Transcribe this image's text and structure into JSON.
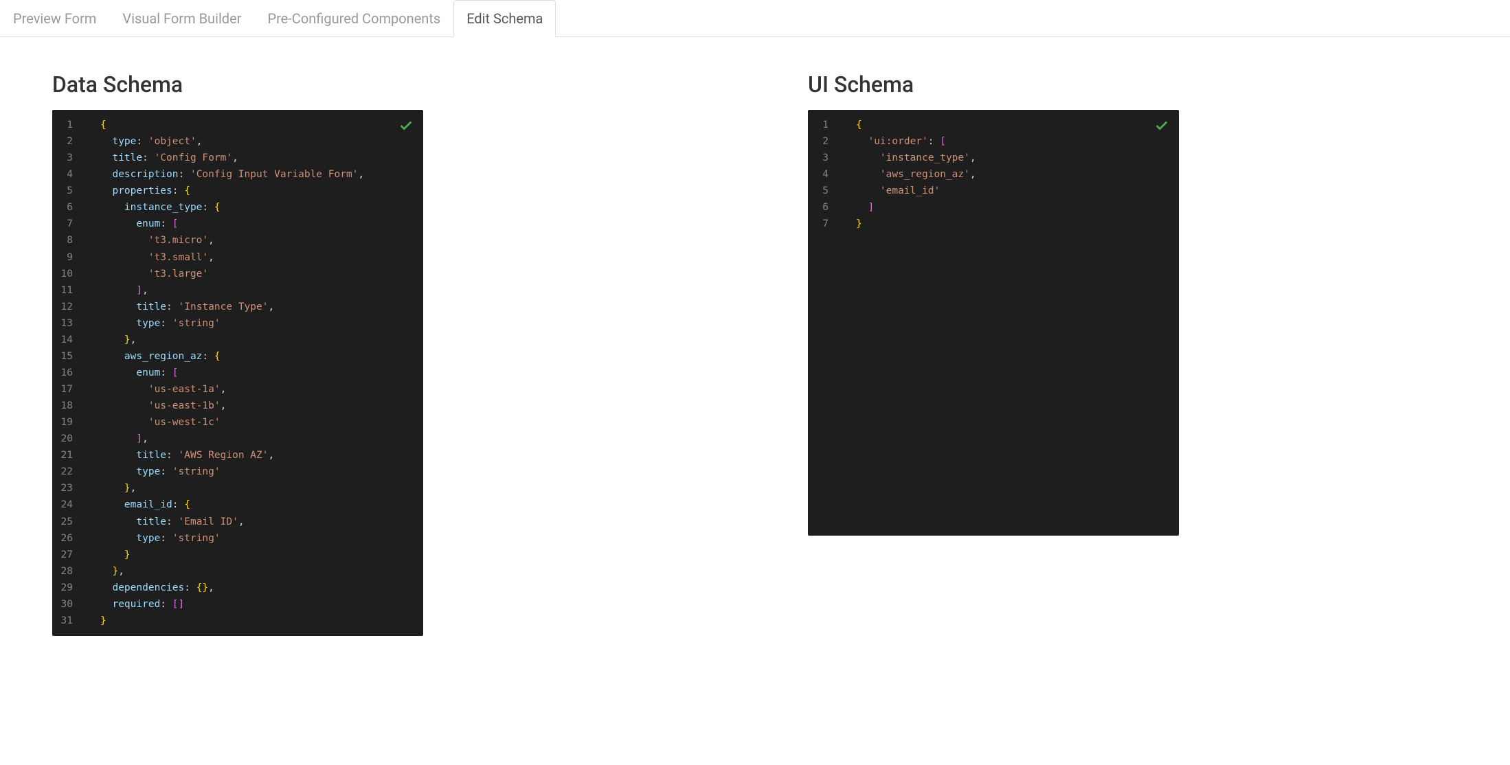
{
  "tabs": {
    "preview": "Preview Form",
    "builder": "Visual Form Builder",
    "precfg": "Pre-Configured Components",
    "edit": "Edit Schema"
  },
  "left": {
    "title": "Data Schema",
    "lines": [
      [
        {
          "t": "{",
          "c": "brace"
        }
      ],
      [
        {
          "t": "  "
        },
        {
          "t": "type",
          "c": "key"
        },
        {
          "t": ": "
        },
        {
          "t": "'object'",
          "c": "str"
        },
        {
          "t": ","
        }
      ],
      [
        {
          "t": "  "
        },
        {
          "t": "title",
          "c": "key"
        },
        {
          "t": ": "
        },
        {
          "t": "'Config Form'",
          "c": "str"
        },
        {
          "t": ","
        }
      ],
      [
        {
          "t": "  "
        },
        {
          "t": "description",
          "c": "key"
        },
        {
          "t": ": "
        },
        {
          "t": "'Config Input Variable Form'",
          "c": "str"
        },
        {
          "t": ","
        }
      ],
      [
        {
          "t": "  "
        },
        {
          "t": "properties",
          "c": "key"
        },
        {
          "t": ": "
        },
        {
          "t": "{",
          "c": "brace"
        }
      ],
      [
        {
          "t": "    "
        },
        {
          "t": "instance_type",
          "c": "key"
        },
        {
          "t": ": "
        },
        {
          "t": "{",
          "c": "brace"
        }
      ],
      [
        {
          "t": "      "
        },
        {
          "t": "enum",
          "c": "key"
        },
        {
          "t": ": "
        },
        {
          "t": "[",
          "c": "bracket"
        }
      ],
      [
        {
          "t": "        "
        },
        {
          "t": "'t3.micro'",
          "c": "str"
        },
        {
          "t": ","
        }
      ],
      [
        {
          "t": "        "
        },
        {
          "t": "'t3.small'",
          "c": "str"
        },
        {
          "t": ","
        }
      ],
      [
        {
          "t": "        "
        },
        {
          "t": "'t3.large'",
          "c": "str"
        }
      ],
      [
        {
          "t": "      "
        },
        {
          "t": "]",
          "c": "bracket"
        },
        {
          "t": ","
        }
      ],
      [
        {
          "t": "      "
        },
        {
          "t": "title",
          "c": "key"
        },
        {
          "t": ": "
        },
        {
          "t": "'Instance Type'",
          "c": "str"
        },
        {
          "t": ","
        }
      ],
      [
        {
          "t": "      "
        },
        {
          "t": "type",
          "c": "key"
        },
        {
          "t": ": "
        },
        {
          "t": "'string'",
          "c": "str"
        }
      ],
      [
        {
          "t": "    "
        },
        {
          "t": "}",
          "c": "brace"
        },
        {
          "t": ","
        }
      ],
      [
        {
          "t": "    "
        },
        {
          "t": "aws_region_az",
          "c": "key"
        },
        {
          "t": ": "
        },
        {
          "t": "{",
          "c": "brace"
        }
      ],
      [
        {
          "t": "      "
        },
        {
          "t": "enum",
          "c": "key"
        },
        {
          "t": ": "
        },
        {
          "t": "[",
          "c": "bracket"
        }
      ],
      [
        {
          "t": "        "
        },
        {
          "t": "'us-east-1a'",
          "c": "str"
        },
        {
          "t": ","
        }
      ],
      [
        {
          "t": "        "
        },
        {
          "t": "'us-east-1b'",
          "c": "str"
        },
        {
          "t": ","
        }
      ],
      [
        {
          "t": "        "
        },
        {
          "t": "'us-west-1c'",
          "c": "str"
        }
      ],
      [
        {
          "t": "      "
        },
        {
          "t": "]",
          "c": "bracket"
        },
        {
          "t": ","
        }
      ],
      [
        {
          "t": "      "
        },
        {
          "t": "title",
          "c": "key"
        },
        {
          "t": ": "
        },
        {
          "t": "'AWS Region AZ'",
          "c": "str"
        },
        {
          "t": ","
        }
      ],
      [
        {
          "t": "      "
        },
        {
          "t": "type",
          "c": "key"
        },
        {
          "t": ": "
        },
        {
          "t": "'string'",
          "c": "str"
        }
      ],
      [
        {
          "t": "    "
        },
        {
          "t": "}",
          "c": "brace"
        },
        {
          "t": ","
        }
      ],
      [
        {
          "t": "    "
        },
        {
          "t": "email_id",
          "c": "key"
        },
        {
          "t": ": "
        },
        {
          "t": "{",
          "c": "brace"
        }
      ],
      [
        {
          "t": "      "
        },
        {
          "t": "title",
          "c": "key"
        },
        {
          "t": ": "
        },
        {
          "t": "'Email ID'",
          "c": "str"
        },
        {
          "t": ","
        }
      ],
      [
        {
          "t": "      "
        },
        {
          "t": "type",
          "c": "key"
        },
        {
          "t": ": "
        },
        {
          "t": "'string'",
          "c": "str"
        }
      ],
      [
        {
          "t": "    "
        },
        {
          "t": "}",
          "c": "brace"
        }
      ],
      [
        {
          "t": "  "
        },
        {
          "t": "}",
          "c": "brace"
        },
        {
          "t": ","
        }
      ],
      [
        {
          "t": "  "
        },
        {
          "t": "dependencies",
          "c": "key"
        },
        {
          "t": ": "
        },
        {
          "t": "{}",
          "c": "brace"
        },
        {
          "t": ","
        }
      ],
      [
        {
          "t": "  "
        },
        {
          "t": "required",
          "c": "key"
        },
        {
          "t": ": "
        },
        {
          "t": "[]",
          "c": "bracket"
        }
      ],
      [
        {
          "t": "}",
          "c": "brace"
        }
      ]
    ]
  },
  "right": {
    "title": "UI Schema",
    "lines": [
      [
        {
          "t": "{",
          "c": "brace"
        }
      ],
      [
        {
          "t": "  "
        },
        {
          "t": "'ui:order'",
          "c": "str"
        },
        {
          "t": ": "
        },
        {
          "t": "[",
          "c": "bracket"
        }
      ],
      [
        {
          "t": "    "
        },
        {
          "t": "'instance_type'",
          "c": "str"
        },
        {
          "t": ","
        }
      ],
      [
        {
          "t": "    "
        },
        {
          "t": "'aws_region_az'",
          "c": "str"
        },
        {
          "t": ","
        }
      ],
      [
        {
          "t": "    "
        },
        {
          "t": "'email_id'",
          "c": "str"
        }
      ],
      [
        {
          "t": "  "
        },
        {
          "t": "]",
          "c": "bracket"
        }
      ],
      [
        {
          "t": "}",
          "c": "brace"
        }
      ]
    ]
  }
}
